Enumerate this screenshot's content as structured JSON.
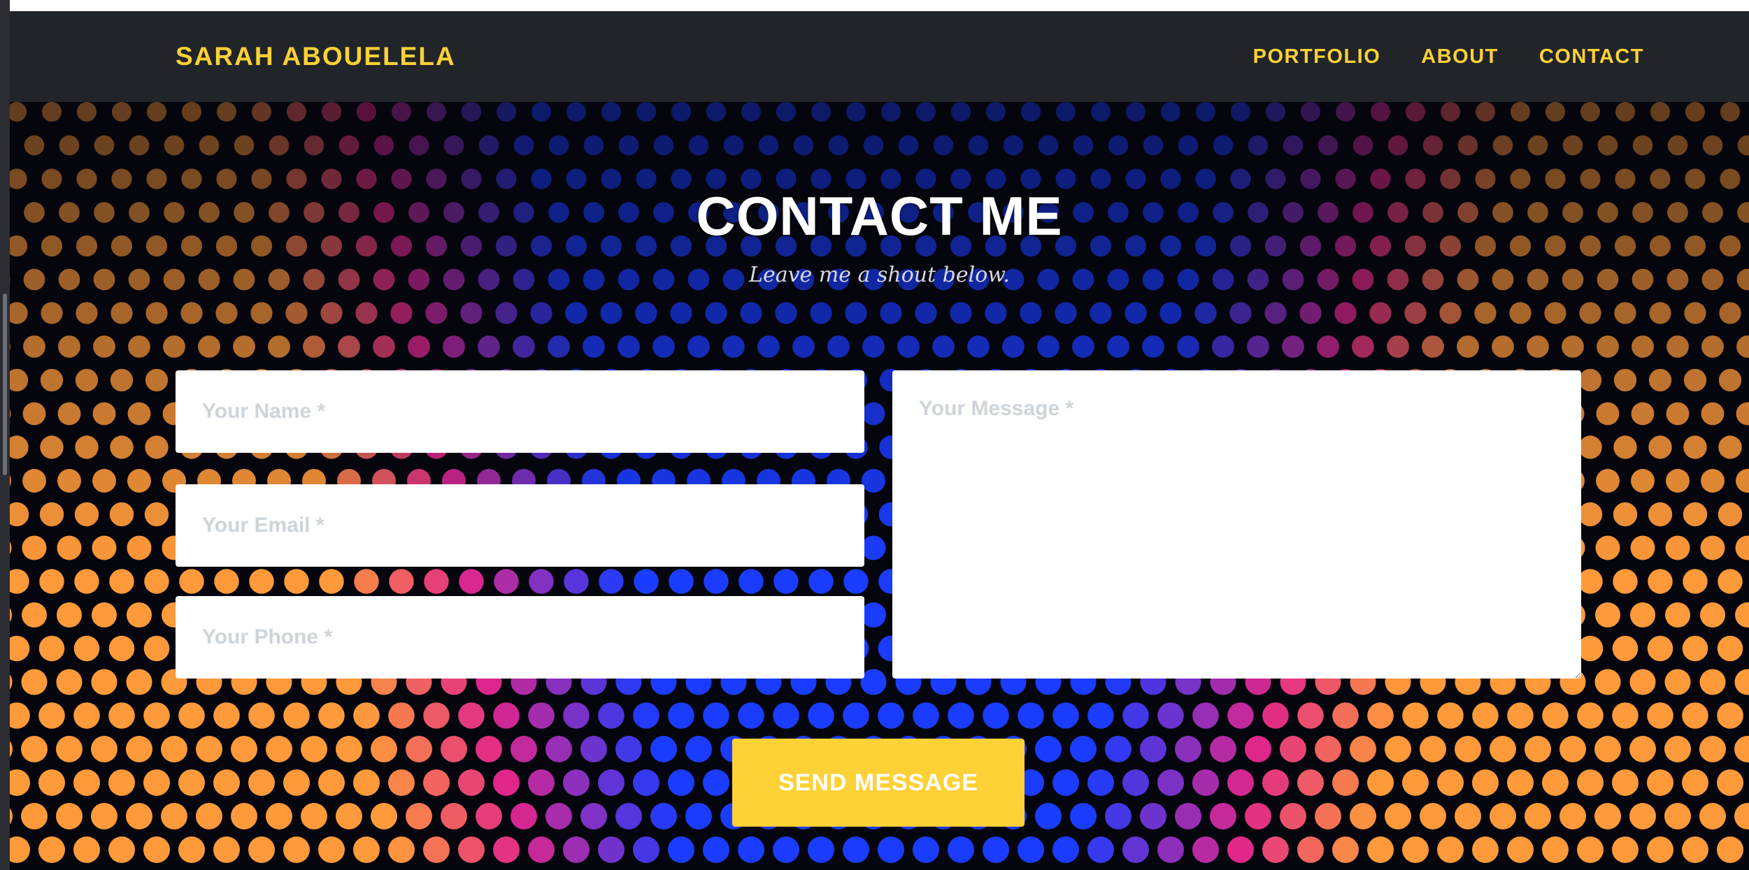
{
  "navbar": {
    "brand": "SARAH ABOUELELA",
    "links": [
      {
        "label": "PORTFOLIO"
      },
      {
        "label": "ABOUT"
      },
      {
        "label": "CONTACT"
      }
    ]
  },
  "contact": {
    "title": "CONTACT ME",
    "subtitle": "Leave me a shout below.",
    "name_placeholder": "Your Name *",
    "email_placeholder": "Your Email *",
    "phone_placeholder": "Your Phone *",
    "message_placeholder": "Your Message *",
    "send_label": "SEND MESSAGE"
  },
  "colors": {
    "accent": "#fed136",
    "navbar_bg": "#212529",
    "dot_blue": "#1a3cff",
    "dot_magenta": "#e0268a",
    "dot_orange": "#ff9a3a"
  }
}
